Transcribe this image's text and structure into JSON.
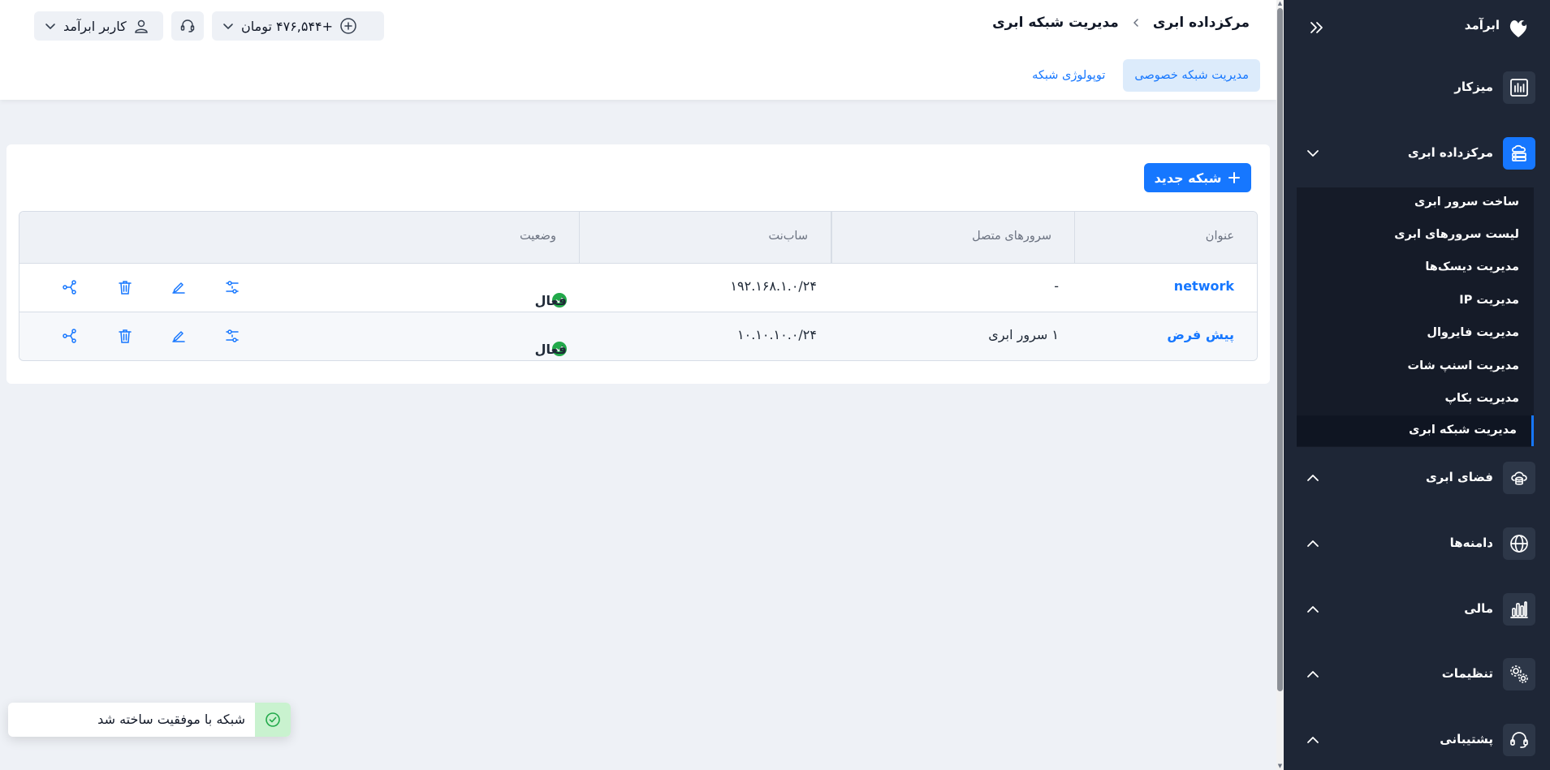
{
  "app": {
    "brand_name": "ابرآمد",
    "colors": {
      "accent": "#1677ff",
      "sidebar_bg": "#1e2636",
      "success": "#22a94a"
    }
  },
  "sidebar": {
    "items": [
      {
        "label": "میزکار",
        "icon": "dashboard-chart-icon"
      },
      {
        "label": "مرکزداده ابری",
        "icon": "datacenter-icon",
        "expanded": true
      },
      {
        "label": "فضای ابری",
        "icon": "cloud-storage-icon"
      },
      {
        "label": "دامنه‌ها",
        "icon": "globe-icon"
      },
      {
        "label": "مالی",
        "icon": "finance-chart-icon"
      },
      {
        "label": "تنظیمات",
        "icon": "gears-icon"
      },
      {
        "label": "پشتیبانی",
        "icon": "headset-icon"
      }
    ],
    "submenu": [
      "ساخت سرور ابری",
      "لیست سرورهای ابری",
      "مدیریت دیسک‌ها",
      "مدیریت IP",
      "مدیریت فایروال",
      "مدیریت اسنپ شات",
      "مدیریت بکاپ",
      "مدیریت شبکه ابری"
    ],
    "active_submenu_index": 7
  },
  "header": {
    "breadcrumb": {
      "parent": "مرکزداده ابری",
      "current": "مدیریت شبکه ابری"
    },
    "balance": "+۴۷۶,۵۴۴ تومان",
    "user_label": "کاربر ابرآمد"
  },
  "tabs": [
    {
      "label": "مدیریت شبکه خصوصی",
      "active": true
    },
    {
      "label": "توپولوژی شبکه",
      "active": false
    }
  ],
  "main": {
    "new_button_label": "شبکه جدید",
    "table": {
      "columns": [
        "عنوان",
        "سرورهای متصل",
        "ساب‌نت",
        "وضعیت"
      ],
      "rows": [
        {
          "name": "network",
          "servers": "-",
          "subnet": "۱۹۲.۱۶۸.۱.۰/۲۴",
          "status": "فعال"
        },
        {
          "name": "پیش فرض",
          "servers": "۱ سرور ابری",
          "subnet": "۱۰.۱۰.۱۰.۰/۲۴",
          "status": "فعال"
        }
      ]
    }
  },
  "toast": {
    "message": "شبکه با موفقیت ساخته شد"
  }
}
